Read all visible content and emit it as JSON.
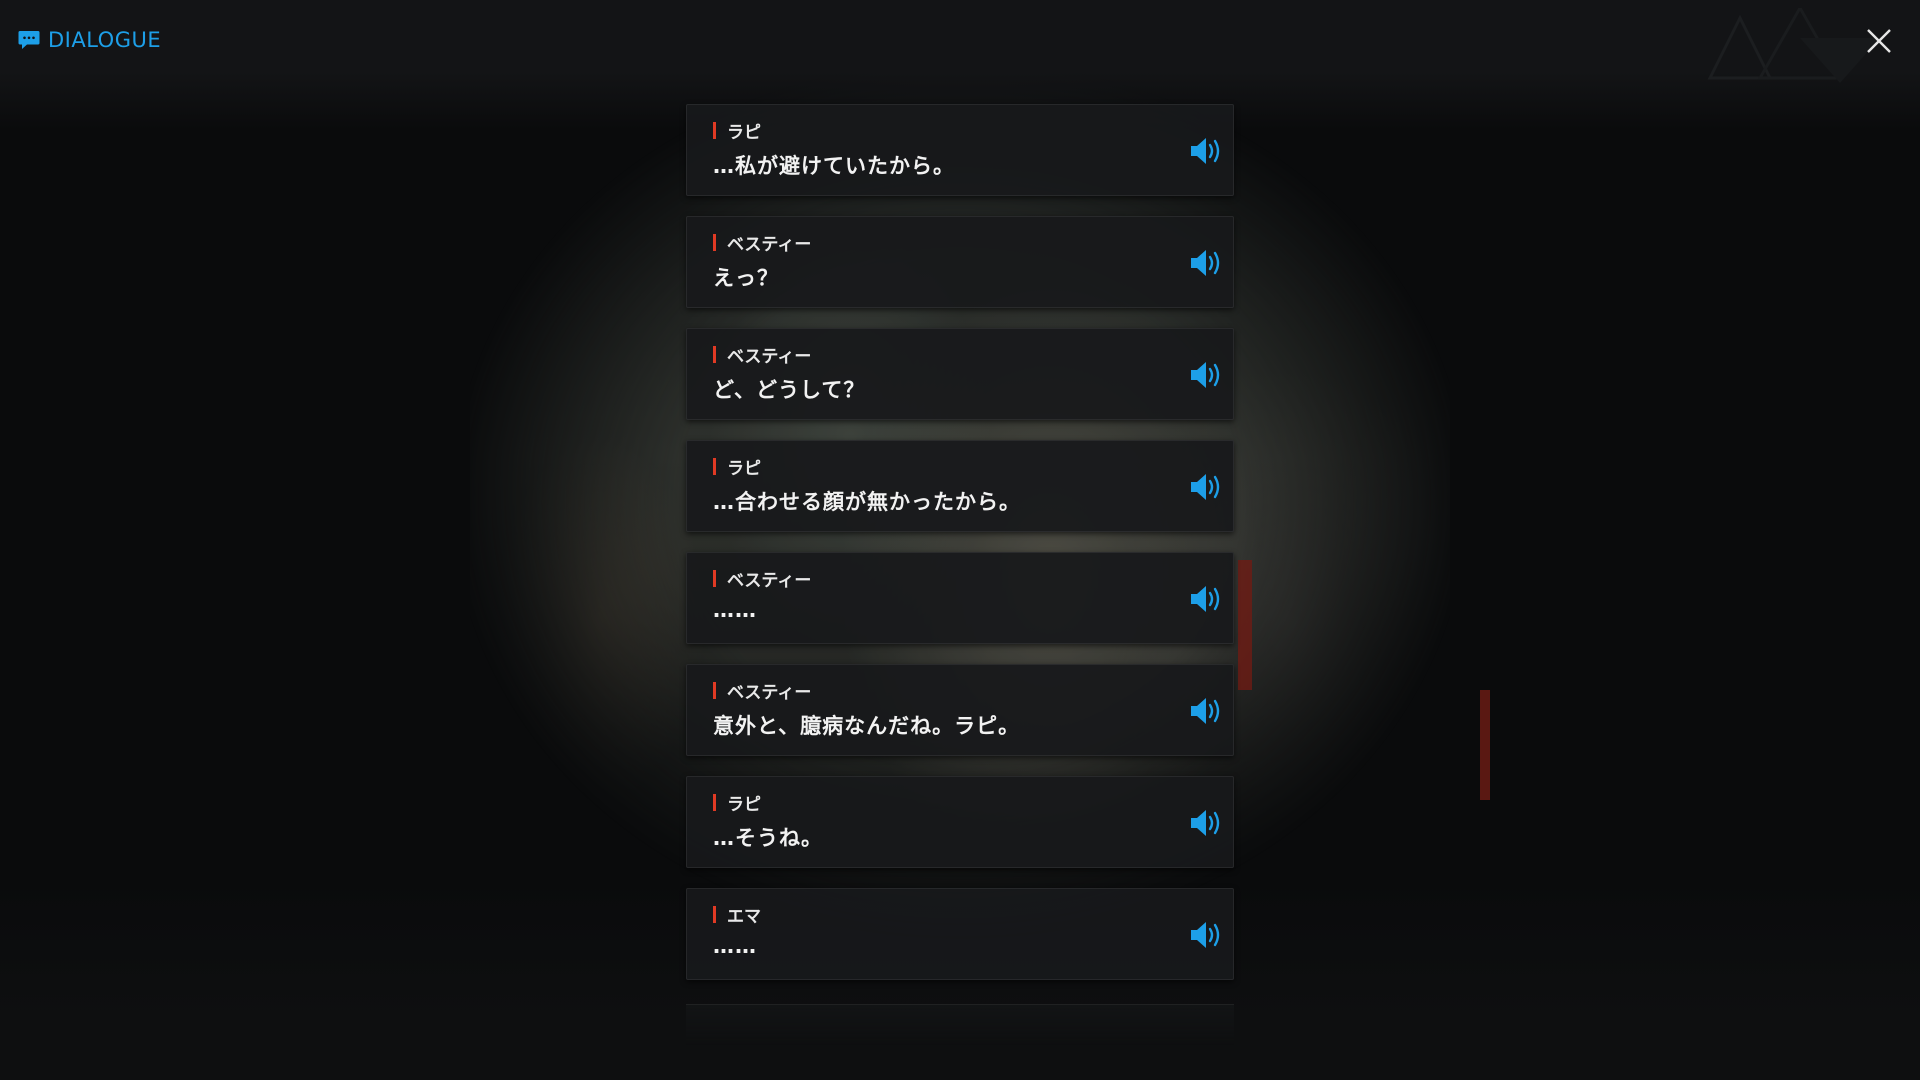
{
  "header": {
    "title": "DIALOGUE",
    "icon": "chat-bubble-icon",
    "accent_color": "#1d9fe8"
  },
  "close_button": {
    "icon": "close-icon"
  },
  "colors": {
    "speaker_marker": "#e03a24",
    "voice_icon": "#1d9fe8",
    "entry_background": "#18191b"
  },
  "dialogue": [
    {
      "speaker": "ラピ",
      "text": "…私が避けていたから。",
      "voice_icon": "speaker-icon"
    },
    {
      "speaker": "ベスティー",
      "text": "えっ？",
      "voice_icon": "speaker-icon"
    },
    {
      "speaker": "ベスティー",
      "text": "ど、どうして？",
      "voice_icon": "speaker-icon"
    },
    {
      "speaker": "ラピ",
      "text": "…合わせる顔が無かったから。",
      "voice_icon": "speaker-icon"
    },
    {
      "speaker": "ベスティー",
      "text": "……",
      "voice_icon": "speaker-icon"
    },
    {
      "speaker": "ベスティー",
      "text": "意外と、臆病なんだね。ラピ。",
      "voice_icon": "speaker-icon"
    },
    {
      "speaker": "ラピ",
      "text": "…そうね。",
      "voice_icon": "speaker-icon"
    },
    {
      "speaker": "エマ",
      "text": "……",
      "voice_icon": "speaker-icon"
    }
  ]
}
